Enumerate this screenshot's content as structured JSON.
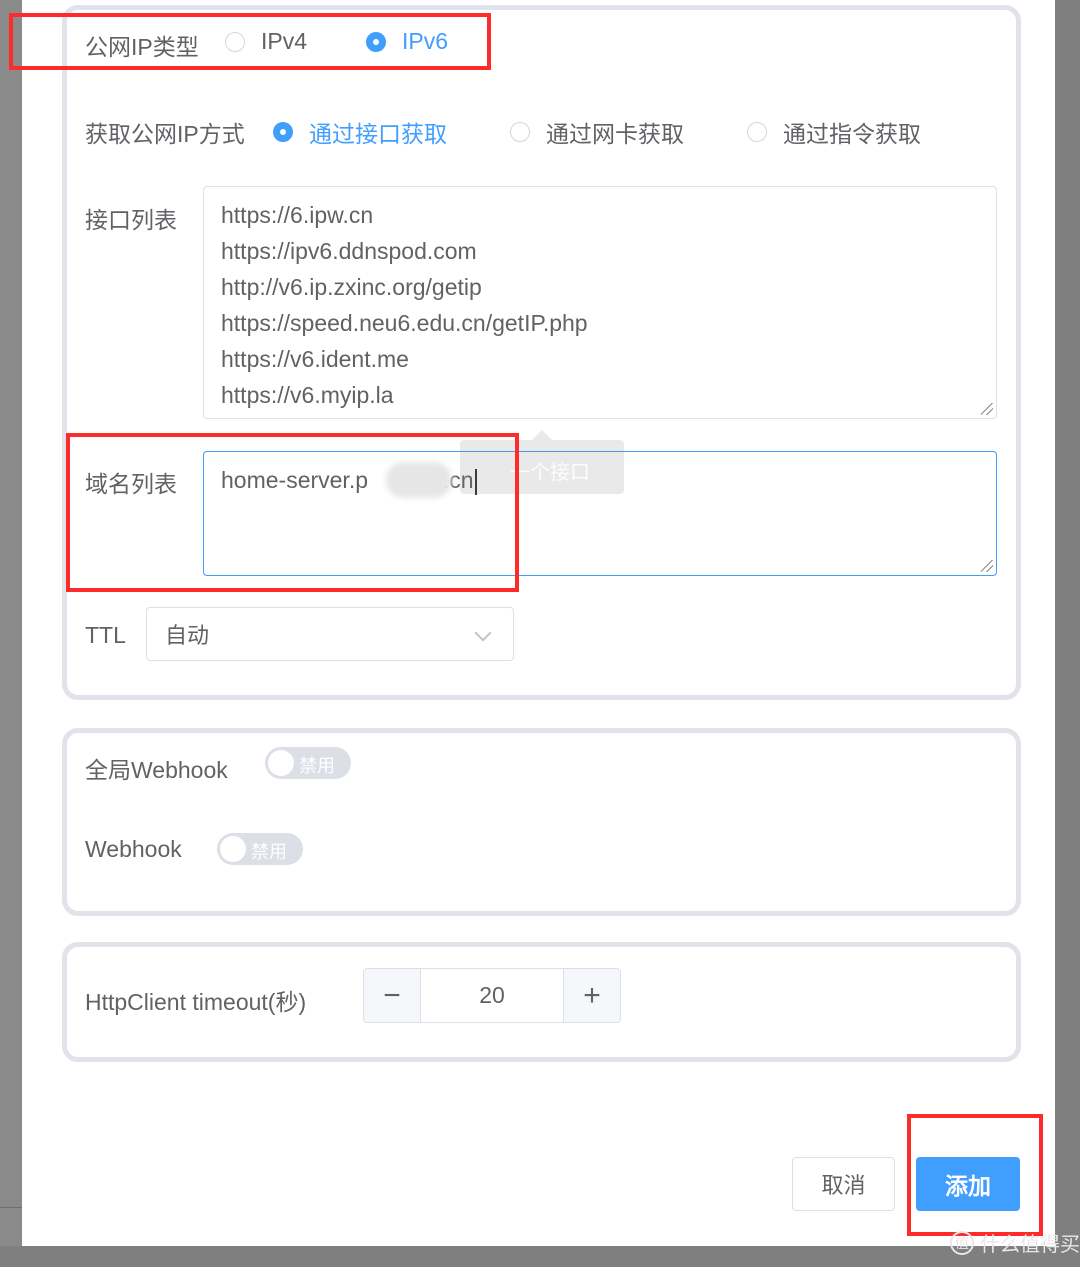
{
  "ip_type": {
    "label": "公网IP类型",
    "options": [
      {
        "label": "IPv4",
        "checked": false
      },
      {
        "label": "IPv6",
        "checked": true
      }
    ]
  },
  "fetch_method": {
    "label": "获取公网IP方式",
    "options": [
      {
        "label": "通过接口获取",
        "checked": true
      },
      {
        "label": "通过网卡获取",
        "checked": false
      },
      {
        "label": "通过指令获取",
        "checked": false
      }
    ]
  },
  "interface_list": {
    "label": "接口列表",
    "value": "https://6.ipw.cn\nhttps://ipv6.ddnspod.com\nhttp://v6.ip.zxinc.org/getip\nhttps://speed.neu6.edu.cn/getIP.php\nhttps://v6.ident.me\nhttps://v6.myip.la"
  },
  "domain_list": {
    "label": "域名列表",
    "value_prefix": "home-server.p",
    "value_suffix": "e.cn"
  },
  "tooltip": {
    "text": "一个接口"
  },
  "ttl": {
    "label": "TTL",
    "value": "自动"
  },
  "webhook": {
    "global_label": "全局Webhook",
    "global_state": "禁用",
    "label": "Webhook",
    "state": "禁用"
  },
  "http_client": {
    "label": "HttpClient timeout(秒)",
    "value": "20",
    "minus": "−",
    "plus": "+"
  },
  "footer": {
    "cancel": "取消",
    "add": "添加"
  },
  "watermark": {
    "text": "什么值得买",
    "logo": "值"
  },
  "colors": {
    "primary": "#409eff",
    "highlight": "#ff2a2a",
    "text": "#606266"
  }
}
